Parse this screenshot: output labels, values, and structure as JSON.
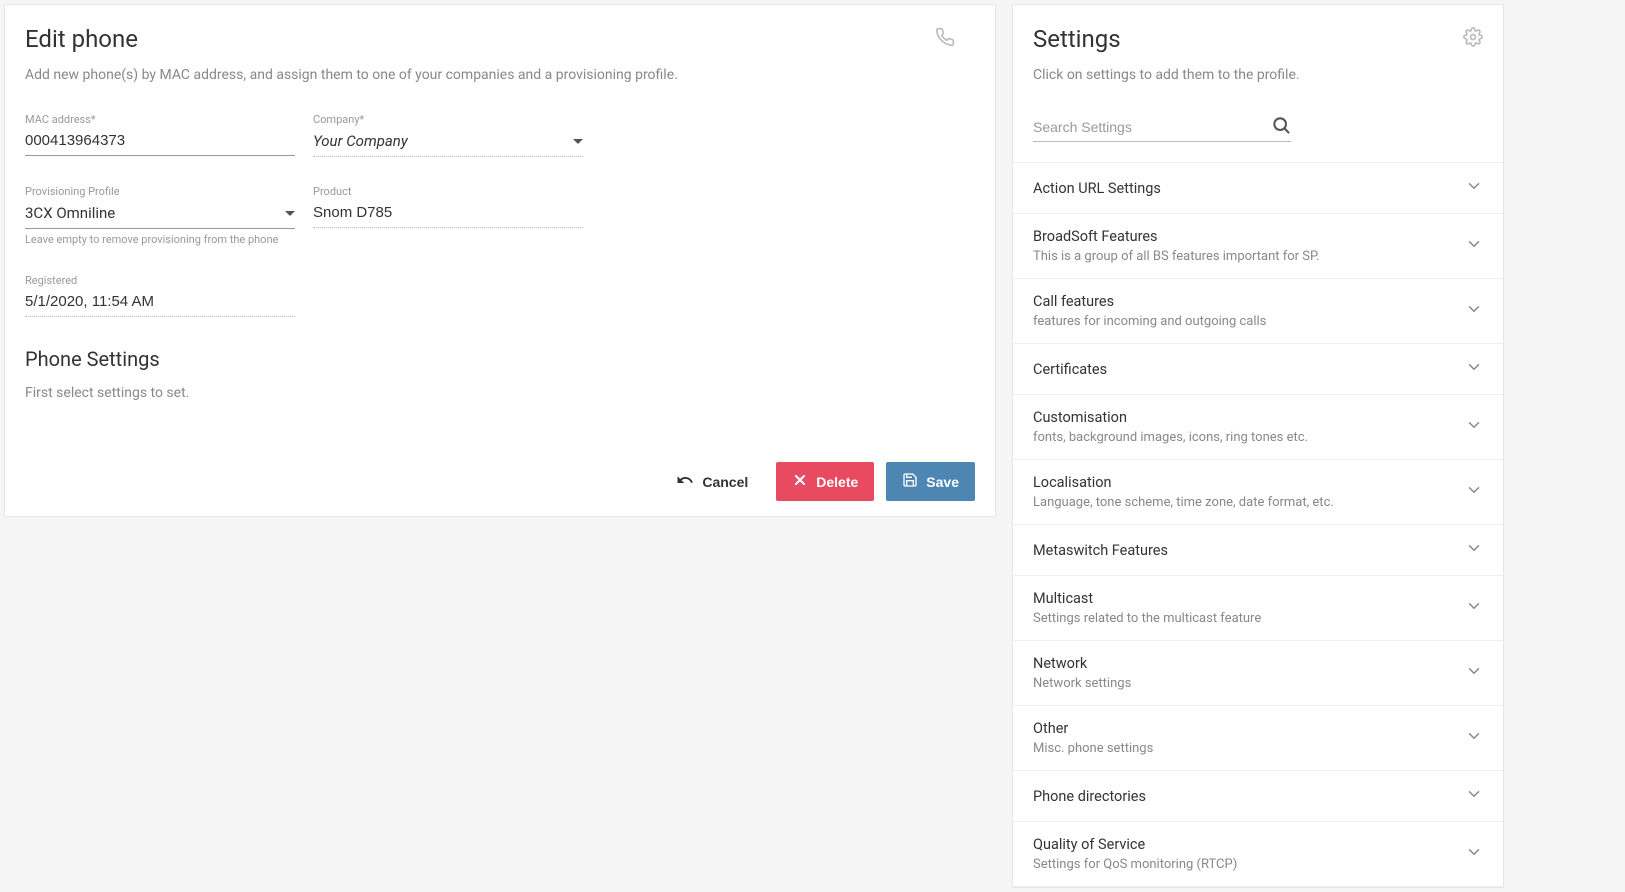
{
  "editPhone": {
    "title": "Edit phone",
    "subtitle": "Add new phone(s) by MAC address, and assign them to one of your companies and a provisioning profile.",
    "fields": {
      "mac": {
        "label": "MAC address*",
        "value": "000413964373"
      },
      "company": {
        "label": "Company*",
        "value": "Your Company"
      },
      "profile": {
        "label": "Provisioning Profile",
        "value": "3CX Omniline",
        "hint": "Leave empty to remove provisioning from the phone"
      },
      "product": {
        "label": "Product",
        "value": "Snom D785"
      },
      "registered": {
        "label": "Registered",
        "value": "5/1/2020, 11:54 AM"
      }
    },
    "phoneSettings": {
      "title": "Phone Settings",
      "subtitle": "First select settings to set."
    },
    "actions": {
      "cancel": "Cancel",
      "delete": "Delete",
      "save": "Save"
    }
  },
  "settings": {
    "title": "Settings",
    "subtitle": "Click on settings to add them to the profile.",
    "searchPlaceholder": "Search Settings",
    "groups": [
      {
        "title": "Action URL Settings",
        "sub": ""
      },
      {
        "title": "BroadSoft Features",
        "sub": "This is a group of all BS features important for SP."
      },
      {
        "title": "Call features",
        "sub": "features for incoming and outgoing calls"
      },
      {
        "title": "Certificates",
        "sub": ""
      },
      {
        "title": "Customisation",
        "sub": "fonts, background images, icons, ring tones etc."
      },
      {
        "title": "Localisation",
        "sub": "Language, tone scheme, time zone, date format, etc."
      },
      {
        "title": "Metaswitch Features",
        "sub": ""
      },
      {
        "title": "Multicast",
        "sub": "Settings related to the multicast feature"
      },
      {
        "title": "Network",
        "sub": "Network settings"
      },
      {
        "title": "Other",
        "sub": "Misc. phone settings"
      },
      {
        "title": "Phone directories",
        "sub": ""
      },
      {
        "title": "Quality of Service",
        "sub": "Settings for QoS monitoring (RTCP)"
      }
    ]
  }
}
